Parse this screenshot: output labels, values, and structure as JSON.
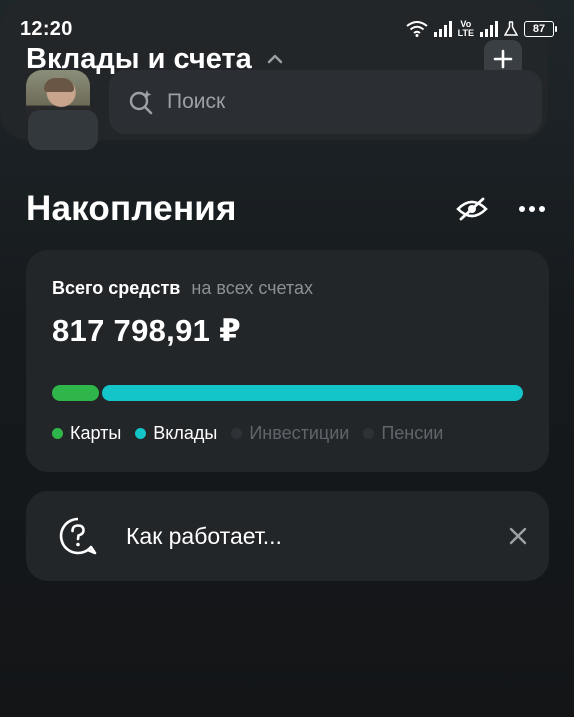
{
  "status_bar": {
    "time": "12:20",
    "volte_top": "Vo",
    "volte_bottom": "LTE",
    "battery": "87"
  },
  "search": {
    "placeholder": "Поиск"
  },
  "header": {
    "title": "Накопления"
  },
  "total_card": {
    "label_strong": "Всего средств",
    "label_muted": "на всех счетах",
    "amount": "817 798,91 ₽",
    "progress": [
      {
        "name": "Карты",
        "fraction": 0.1,
        "color": "#2fb64a"
      },
      {
        "name": "Вклады",
        "fraction": 0.9,
        "color": "#13c4c9"
      }
    ],
    "legend": [
      {
        "label": "Карты",
        "color": "#2fb64a",
        "active": true
      },
      {
        "label": "Вклады",
        "color": "#13c4c9",
        "active": true
      },
      {
        "label": "Инвестиции",
        "color": "#2e3236",
        "active": false
      },
      {
        "label": "Пенсии",
        "color": "#2e3236",
        "active": false
      }
    ]
  },
  "info_card": {
    "text": "Как работает..."
  },
  "accounts": {
    "title": "Вклады и счета"
  },
  "icons": {
    "search": "search-sparkle-icon",
    "hide": "eye-off-icon",
    "more": "more-dots-icon",
    "help": "question-bubble-icon",
    "close": "close-icon",
    "collapse": "chevron-up-icon",
    "add": "plus-icon"
  }
}
